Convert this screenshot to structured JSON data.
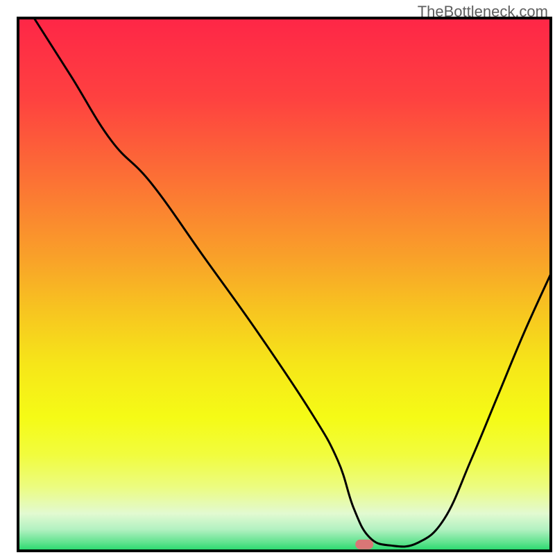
{
  "watermark": "TheBottleneck.com",
  "chart_data": {
    "type": "line",
    "title": "",
    "xlabel": "",
    "ylabel": "",
    "xlim": [
      0,
      100
    ],
    "ylim": [
      0,
      100
    ],
    "x": [
      3,
      10,
      17.5,
      25,
      35,
      45,
      55,
      60,
      63,
      66,
      70,
      75,
      80,
      85,
      90,
      95,
      100
    ],
    "values": [
      100,
      89,
      77,
      69,
      55,
      41,
      26,
      17,
      8,
      2.5,
      1,
      1.5,
      6,
      17,
      29,
      41,
      52
    ],
    "marker": {
      "x": 65,
      "y": 1.2,
      "color": "#d97676"
    },
    "background_gradient": {
      "stops": [
        {
          "offset": 0.0,
          "color": "#fe2647"
        },
        {
          "offset": 0.15,
          "color": "#fe4140"
        },
        {
          "offset": 0.3,
          "color": "#fc7035"
        },
        {
          "offset": 0.45,
          "color": "#f9a129"
        },
        {
          "offset": 0.55,
          "color": "#f7c520"
        },
        {
          "offset": 0.65,
          "color": "#f6e619"
        },
        {
          "offset": 0.75,
          "color": "#f5fb16"
        },
        {
          "offset": 0.82,
          "color": "#f1fc3e"
        },
        {
          "offset": 0.88,
          "color": "#ecfc80"
        },
        {
          "offset": 0.93,
          "color": "#e2fad1"
        },
        {
          "offset": 0.96,
          "color": "#b2f1c1"
        },
        {
          "offset": 0.985,
          "color": "#5ee28d"
        },
        {
          "offset": 1.0,
          "color": "#23d86b"
        }
      ]
    },
    "frame_color": "#000000",
    "line_color": "#000000"
  }
}
